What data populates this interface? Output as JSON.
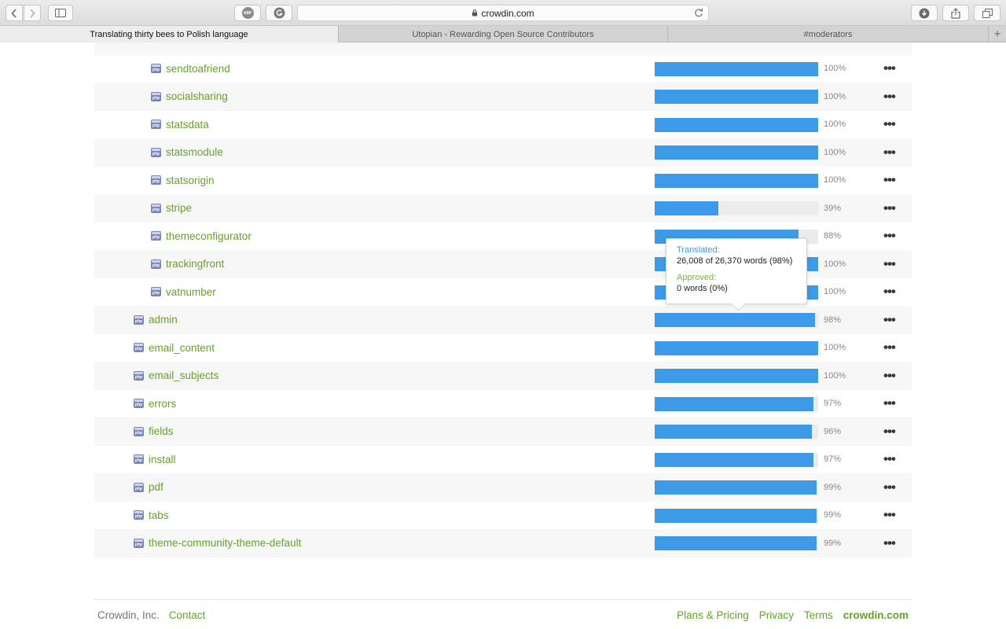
{
  "browser": {
    "url": "crowdin.com",
    "tabs": [
      {
        "label": "Translating thirty bees to Polish language",
        "active": true
      },
      {
        "label": "Utopian - Rewarding Open Source Contributors",
        "active": false
      },
      {
        "label": "#moderators",
        "active": false
      }
    ],
    "new_tab_label": "+",
    "abp_label": "ABP"
  },
  "files": [
    {
      "name": "sendtoafriend",
      "progress": 100,
      "label": "100%",
      "indent": 2
    },
    {
      "name": "socialsharing",
      "progress": 100,
      "label": "100%",
      "indent": 2
    },
    {
      "name": "statsdata",
      "progress": 100,
      "label": "100%",
      "indent": 2
    },
    {
      "name": "statsmodule",
      "progress": 100,
      "label": "100%",
      "indent": 2
    },
    {
      "name": "statsorigin",
      "progress": 100,
      "label": "100%",
      "indent": 2
    },
    {
      "name": "stripe",
      "progress": 39,
      "label": "39%",
      "indent": 2
    },
    {
      "name": "themeconfigurator",
      "progress": 88,
      "label": "88%",
      "indent": 2
    },
    {
      "name": "trackingfront",
      "progress": 100,
      "label": "100%",
      "indent": 2
    },
    {
      "name": "vatnumber",
      "progress": 100,
      "label": "100%",
      "indent": 2
    },
    {
      "name": "admin",
      "progress": 98,
      "label": "98%",
      "indent": 1
    },
    {
      "name": "email_content",
      "progress": 100,
      "label": "100%",
      "indent": 1
    },
    {
      "name": "email_subjects",
      "progress": 100,
      "label": "100%",
      "indent": 1
    },
    {
      "name": "errors",
      "progress": 97,
      "label": "97%",
      "indent": 1
    },
    {
      "name": "fields",
      "progress": 96,
      "label": "96%",
      "indent": 1
    },
    {
      "name": "install",
      "progress": 97,
      "label": "97%",
      "indent": 1
    },
    {
      "name": "pdf",
      "progress": 99,
      "label": "99%",
      "indent": 1
    },
    {
      "name": "tabs",
      "progress": 99,
      "label": "99%",
      "indent": 1
    },
    {
      "name": "theme-community-theme-default",
      "progress": 99,
      "label": "99%",
      "indent": 1
    }
  ],
  "file_icon_text": "php",
  "more_label": "•••",
  "tooltip": {
    "translated_label": "Translated:",
    "translated_value": "26,008 of 26,370 words (98%)",
    "approved_label": "Approved:",
    "approved_value": "0 words (0%)"
  },
  "footer": {
    "company": "Crowdin, Inc.",
    "contact": "Contact",
    "plans": "Plans & Pricing",
    "privacy": "Privacy",
    "terms": "Terms",
    "brand": "crowdin.com"
  },
  "colors": {
    "accent_green": "#66a22d",
    "bar_blue": "#3c9ae8"
  }
}
